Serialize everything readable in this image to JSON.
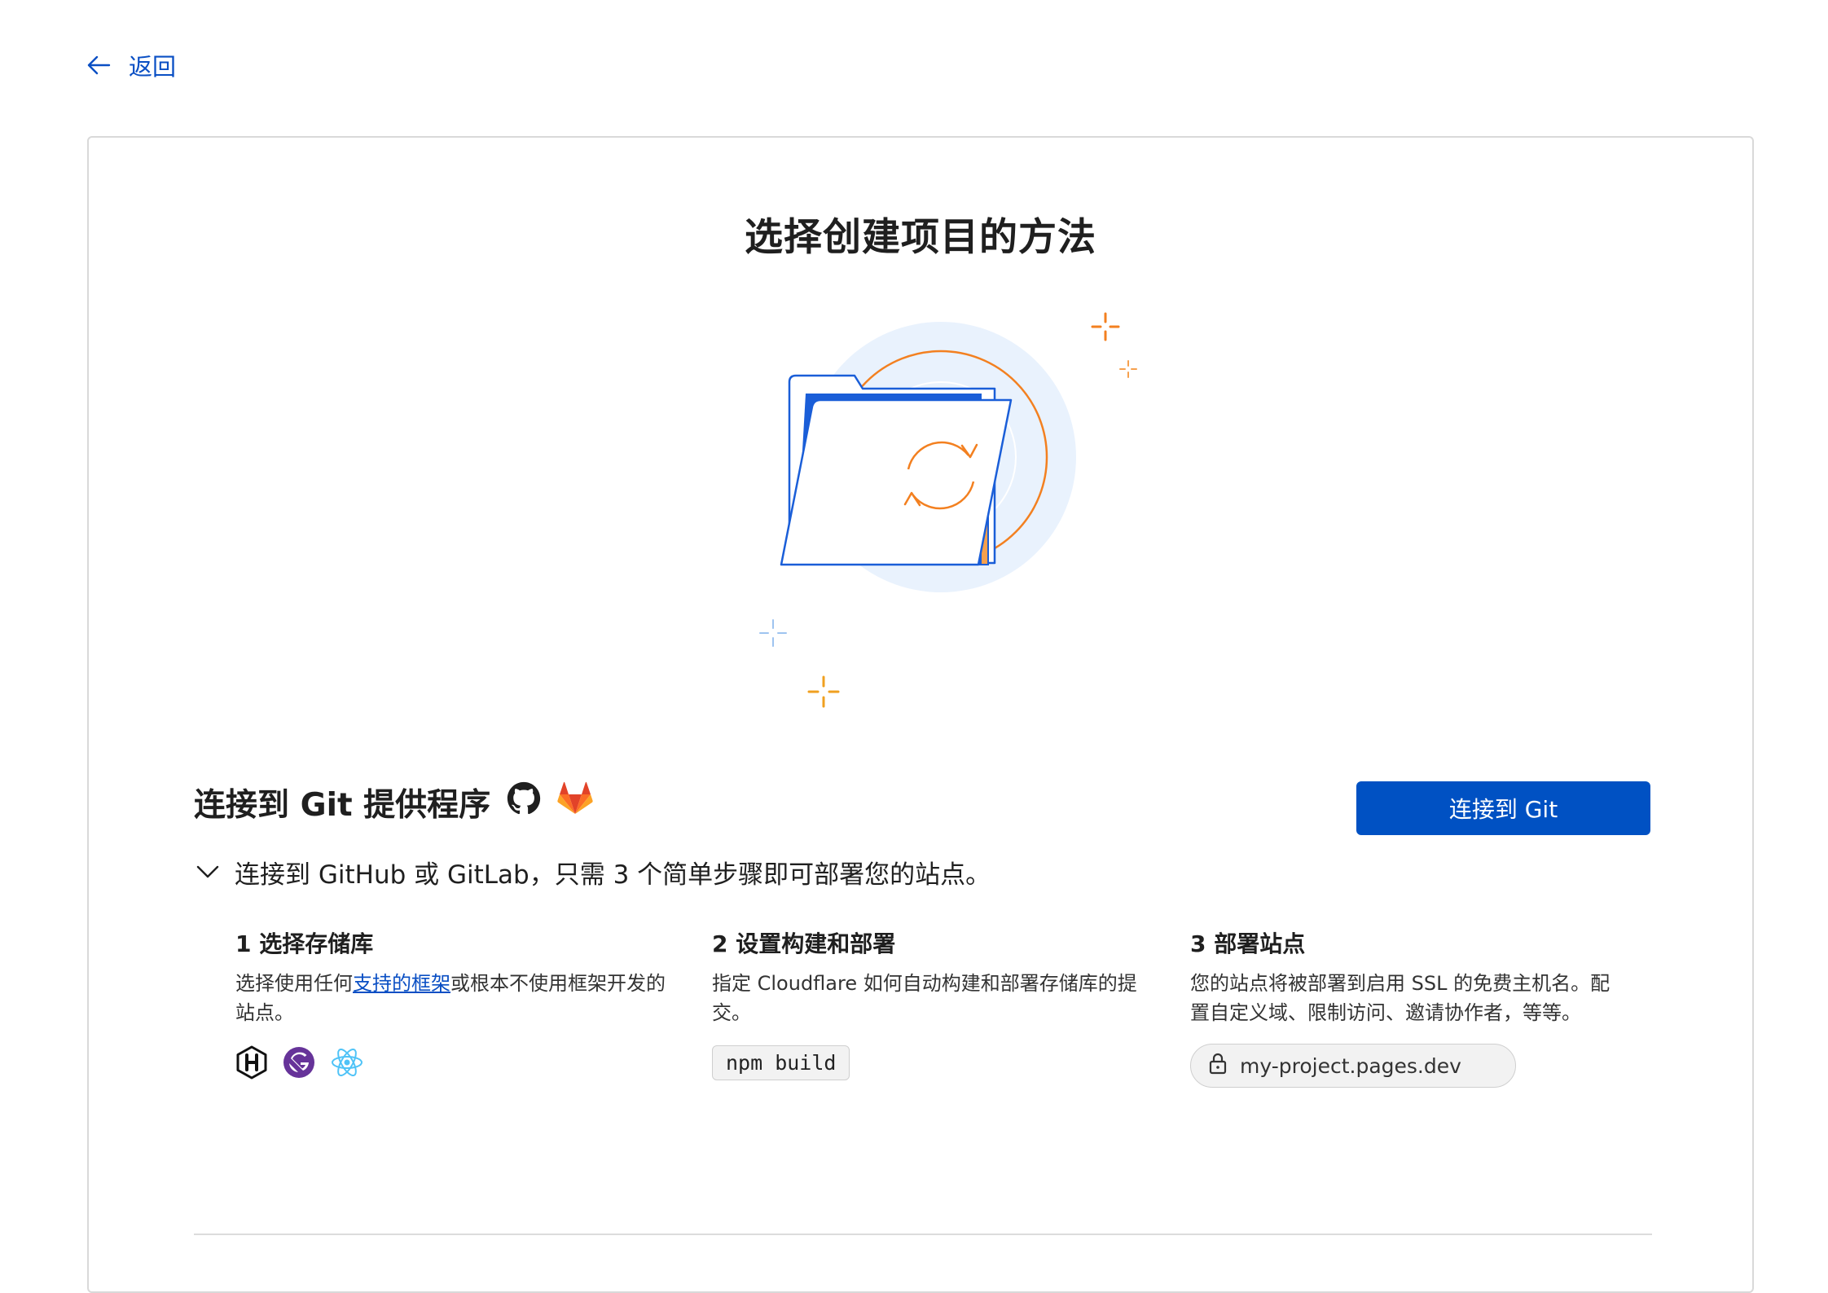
{
  "nav": {
    "back_label": "返回"
  },
  "page": {
    "title": "选择创建项目的方法"
  },
  "icons": {
    "back": "arrow-left-icon",
    "expand": "chevron-down-icon",
    "github": "github-icon",
    "gitlab": "gitlab-icon",
    "hugo": "hugo-icon",
    "gatsby": "gatsby-icon",
    "react": "react-icon",
    "lock": "lock-icon",
    "hero": "folder-sync-illustration"
  },
  "git_section": {
    "heading": "连接到 Git 提供程序",
    "button_label": "连接到 Git",
    "summary": "连接到 GitHub 或 GitLab，只需 3 个简单步骤即可部署您的站点。",
    "steps": [
      {
        "title": "1 选择存储库",
        "desc_before": "选择使用任何",
        "link": "支持的框架",
        "desc_after": "或根本不使用框架开发的站点。"
      },
      {
        "title": "2 设置构建和部署",
        "desc": "指定 Cloudflare 如何自动构建和部署存储库的提交。",
        "code": "npm build"
      },
      {
        "title": "3 部署站点",
        "desc": "您的站点将被部署到启用 SSL 的免费主机名。配置自定义域、限制访问、邀请协作者，等等。",
        "url": "my-project.pages.dev"
      }
    ]
  },
  "colors": {
    "accent": "#0051c3",
    "link": "#0a4fc4",
    "illustration_orange": "#f38020",
    "illustration_blue": "#1a5ed8"
  }
}
